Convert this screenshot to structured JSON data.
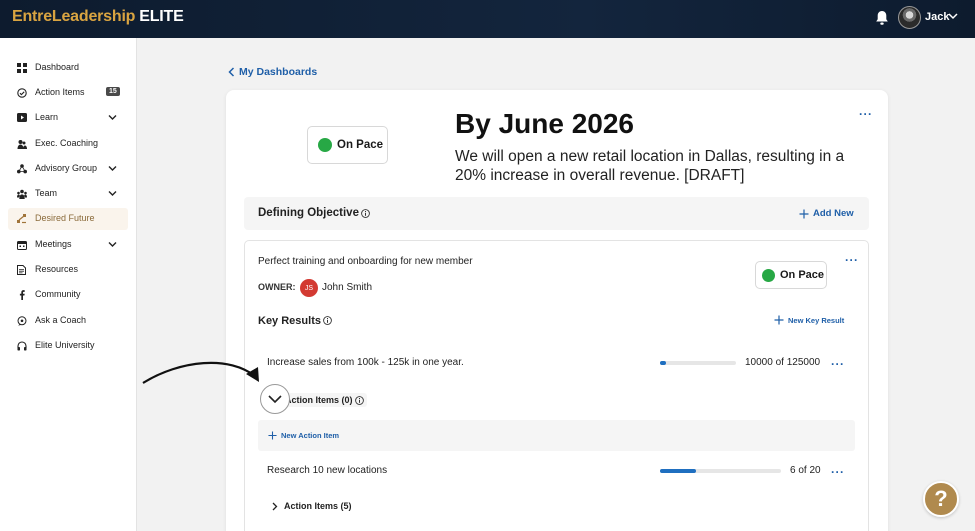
{
  "header": {
    "logo_part1": "EntreLeadership",
    "logo_part2": "ELITE",
    "user_name": "Jack",
    "icons": [
      "bell-icon",
      "avatar",
      "chevron-down-icon"
    ]
  },
  "sidebar": {
    "items": [
      {
        "label": "Dashboard",
        "icon": "grid-icon"
      },
      {
        "label": "Action Items",
        "icon": "check-circle-icon",
        "badge": "15"
      },
      {
        "label": "Learn",
        "icon": "play-icon",
        "has_chevron": true
      },
      {
        "label": "Exec. Coaching",
        "icon": "coaching-icon"
      },
      {
        "label": "Advisory Group",
        "icon": "group-icon",
        "has_chevron": true
      },
      {
        "label": "Team",
        "icon": "team-icon",
        "has_chevron": true
      },
      {
        "label": "Desired Future",
        "icon": "target-icon",
        "active": true
      },
      {
        "label": "Meetings",
        "icon": "calendar-icon",
        "has_chevron": true
      },
      {
        "label": "Resources",
        "icon": "document-icon"
      },
      {
        "label": "Community",
        "icon": "facebook-icon"
      },
      {
        "label": "Ask a Coach",
        "icon": "chat-icon"
      },
      {
        "label": "Elite University",
        "icon": "headphones-icon"
      }
    ]
  },
  "main": {
    "back_link": "My Dashboards",
    "status": "On Pace",
    "title": "By June 2026",
    "subtitle": "We will open a new retail location in Dallas, resulting in a 20% increase in overall revenue. [DRAFT]",
    "defining_objective": {
      "label": "Defining Objective",
      "add_new": "Add New"
    },
    "objective": {
      "text": "Perfect training and onboarding for new member",
      "owner_label": "OWNER:",
      "owner_initials": "JS",
      "owner_name": "John Smith",
      "status": "On Pace"
    },
    "key_results": {
      "label": "Key Results",
      "new_label": "New Key Result",
      "items": [
        {
          "text": "Increase sales from 100k - 125k in one year.",
          "progress_value": "10000 of 125000",
          "progress_fraction": 0.08,
          "action_items_label": "Action Items (0)",
          "new_action_label": "New Action Item"
        },
        {
          "text": "Research 10 new locations",
          "progress_value": "6 of 20",
          "progress_fraction": 0.3,
          "action_items_label": "Action Items (5)"
        }
      ]
    }
  },
  "help_label": "?",
  "colors": {
    "accent_blue": "#1f5fa8",
    "status_green": "#27a845",
    "gold": "#d9a441",
    "help_gold": "#b08a4e",
    "header_navy": "#0d1b2e"
  }
}
